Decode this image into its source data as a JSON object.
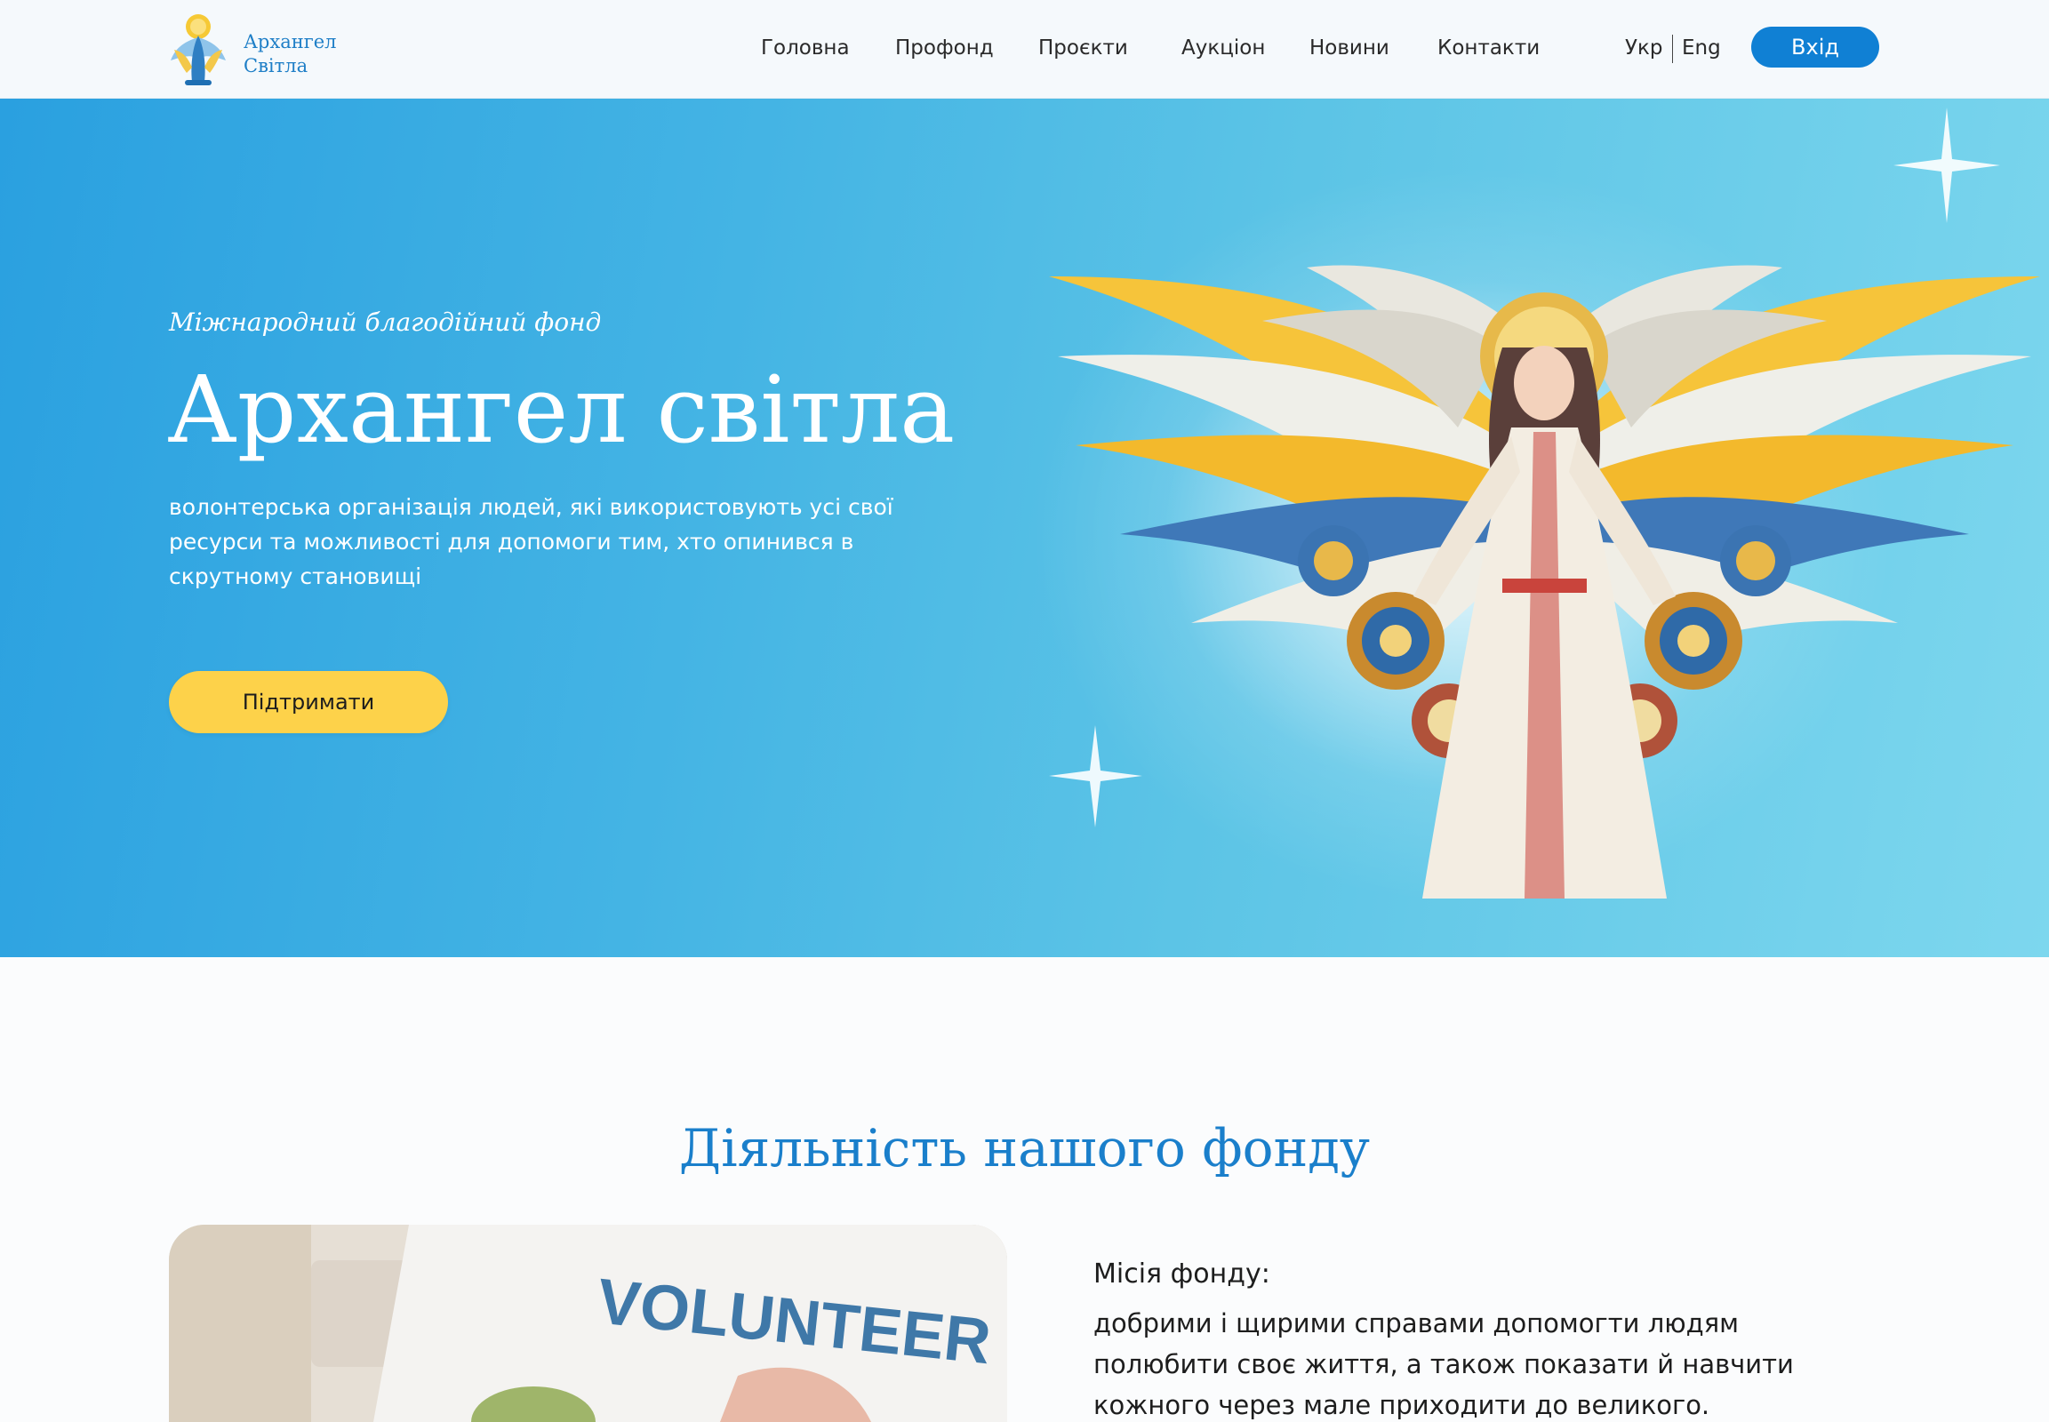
{
  "header": {
    "logo": {
      "line1": "Архангел",
      "line2": "Світла"
    },
    "nav": [
      {
        "label": "Головна"
      },
      {
        "label": "Профонд"
      },
      {
        "label": "Проєкти"
      },
      {
        "label": "Аукціон"
      },
      {
        "label": "Новини"
      },
      {
        "label": "Контакти"
      }
    ],
    "lang": {
      "ukr": "Укр",
      "eng": "Eng"
    },
    "login_label": "Вхід"
  },
  "hero": {
    "subtitle": "Міжнародний благодійний фонд",
    "title": "Архангел світла",
    "description": "волонтерська організація людей, які використовують усі свої ресурси та можливості для допомоги тим, хто опинився в скрутному становищі",
    "support_label": "Підтримати"
  },
  "activity": {
    "title": "Діяльність нашого фонду",
    "photo_text": "VOLUNTEER",
    "mission_label": "Місія фонду:",
    "mission_text": "добрими і щирими справами допомогти людям полюбити своє життя, а також показати й навчити кожного через мале приходити до великого."
  },
  "colors": {
    "brand_blue": "#1080d4",
    "title_blue": "#1a7fcb",
    "accent_yellow": "#fdd24a",
    "hero_gradient_start": "#2aa0e0",
    "hero_gradient_end": "#7dd7ee"
  },
  "icons": {
    "logo": "angel-logo-icon",
    "hero_art": "angel-illustration",
    "sparkle": "sparkle-icon"
  }
}
